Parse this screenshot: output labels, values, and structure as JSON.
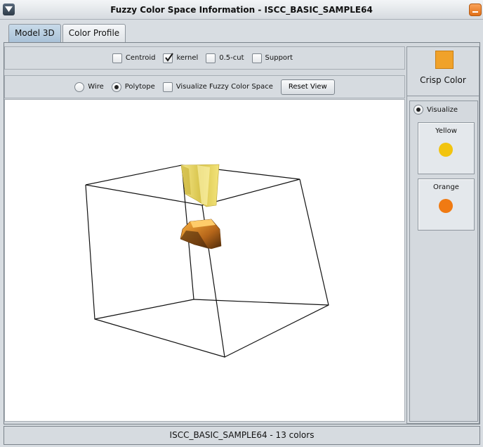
{
  "window": {
    "title": "Fuzzy Color Space Information - ISCC_BASIC_SAMPLE64",
    "menu_icon": "window-menu-icon",
    "minimize_icon": "minimize-icon"
  },
  "tabs": [
    {
      "label": "Model 3D",
      "active": true
    },
    {
      "label": "Color Profile",
      "active": false
    }
  ],
  "toolbar1": {
    "centroid": {
      "label": "Centroid",
      "checked": false
    },
    "kernel": {
      "label": "kernel",
      "checked": true
    },
    "cut": {
      "label": "0.5-cut",
      "checked": false
    },
    "support": {
      "label": "Support",
      "checked": false
    }
  },
  "toolbar2": {
    "wire": {
      "label": "Wire",
      "selected": false
    },
    "polytope": {
      "label": "Polytope",
      "selected": true
    },
    "visualize_space": {
      "label": "Visualize Fuzzy Color Space",
      "checked": false
    },
    "reset_view": "Reset View"
  },
  "sidebar": {
    "crisp_label": "Crisp Color",
    "crisp_color": "#f0a22a",
    "visualize_label": "Visualize",
    "colors": [
      {
        "name": "Yellow",
        "color": "#f2c40f"
      },
      {
        "name": "Orange",
        "color": "#f07a12"
      }
    ]
  },
  "status": "ISCC_BASIC_SAMPLE64 - 13 colors"
}
